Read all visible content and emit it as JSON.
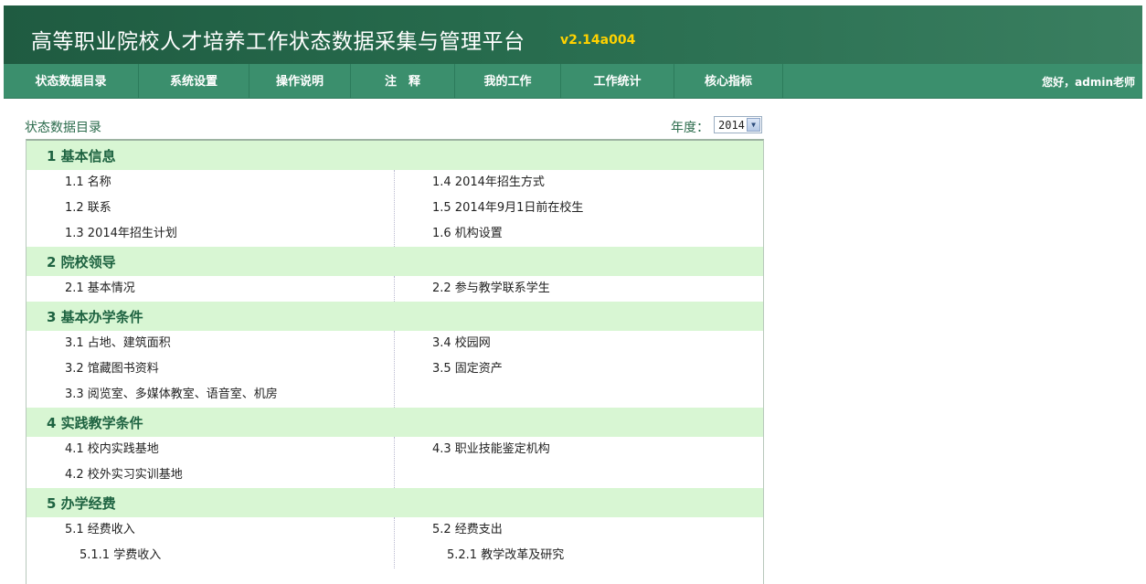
{
  "header": {
    "title": "高等职业院校人才培养工作状态数据采集与管理平台",
    "version": "v2.14a004"
  },
  "nav": {
    "items": [
      {
        "label": "状态数据目录"
      },
      {
        "label": "系统设置"
      },
      {
        "label": "操作说明"
      },
      {
        "label": "注　释"
      },
      {
        "label": "我的工作"
      },
      {
        "label": "工作统计"
      },
      {
        "label": "核心指标"
      }
    ],
    "greeting": "您好，admin老师"
  },
  "page": {
    "title": "状态数据目录",
    "year_label": "年度：",
    "year_value": "2014"
  },
  "sections": [
    {
      "title": "1 基本信息",
      "rows": [
        {
          "left": "1.1 名称",
          "right": "1.4 2014年招生方式"
        },
        {
          "left": "1.2 联系",
          "right": "1.5 2014年9月1日前在校生"
        },
        {
          "left": "1.3 2014年招生计划",
          "right": "1.6 机构设置"
        }
      ]
    },
    {
      "title": "2 院校领导",
      "rows": [
        {
          "left": "2.1 基本情况",
          "right": "2.2 参与教学联系学生"
        }
      ]
    },
    {
      "title": "3 基本办学条件",
      "rows": [
        {
          "left": "3.1 占地、建筑面积",
          "right": "3.4 校园网"
        },
        {
          "left": "3.2 馆藏图书资料",
          "right": "3.5 固定资产"
        },
        {
          "left": "3.3 阅览室、多媒体教室、语音室、机房",
          "right": ""
        }
      ]
    },
    {
      "title": "4 实践教学条件",
      "rows": [
        {
          "left": "4.1 校内实践基地",
          "right": "4.3 职业技能鉴定机构"
        },
        {
          "left": "4.2 校外实习实训基地",
          "right": ""
        }
      ]
    },
    {
      "title": "5 办学经费",
      "rows": [
        {
          "left": "5.1 经费收入",
          "right": "5.2 经费支出"
        },
        {
          "left": "5.1.1 学费收入",
          "right": "5.2.1 教学改革及研究",
          "sub": true
        }
      ]
    }
  ]
}
